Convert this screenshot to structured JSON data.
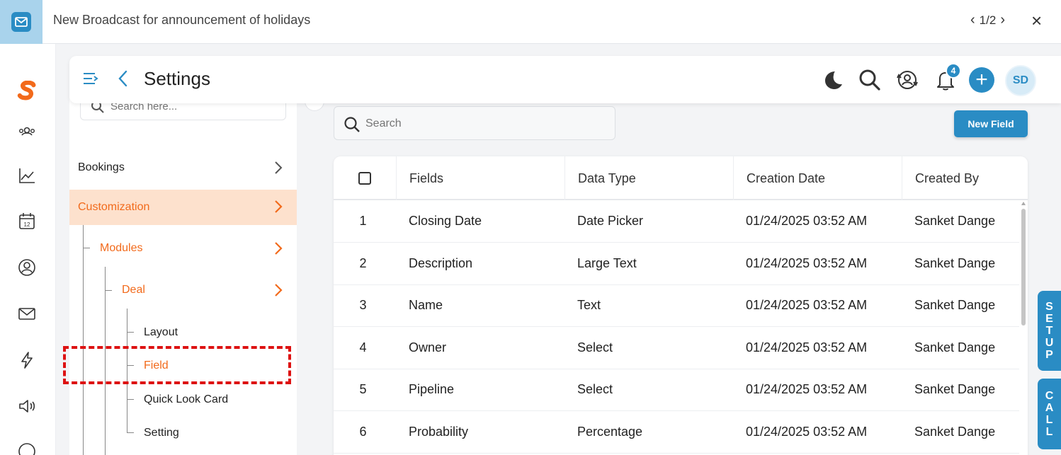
{
  "banner": {
    "text": "New Broadcast for announcement of holidays",
    "pager": "1/2",
    "close_glyph": "×",
    "icon": "mail-icon"
  },
  "rail": {
    "items": [
      "logo-icon",
      "contacts-icon",
      "analytics-icon",
      "calendar-icon",
      "user-icon",
      "mail-icon",
      "bolt-icon",
      "speaker-icon",
      "currency-icon"
    ],
    "calendar_day": "12"
  },
  "header": {
    "title": "Settings",
    "notification_count": "4",
    "plus_glyph": "+",
    "avatar_initials": "SD"
  },
  "side_panel": {
    "search_placeholder": "Search here...",
    "items": {
      "bookings": "Bookings",
      "customization": "Customization",
      "modules": "Modules",
      "deal": "Deal",
      "layout": "Layout",
      "field": "Field",
      "quick_look_card": "Quick Look Card",
      "setting": "Setting"
    }
  },
  "main": {
    "search_placeholder": "Search",
    "new_field_label": "New Field",
    "table": {
      "headers": [
        "Fields",
        "Data Type",
        "Creation Date",
        "Created By"
      ],
      "rows": [
        {
          "num": "1",
          "field": "Closing Date",
          "type": "Date Picker",
          "date": "01/24/2025 03:52 AM",
          "by": "Sanket Dange"
        },
        {
          "num": "2",
          "field": "Description",
          "type": "Large Text",
          "date": "01/24/2025 03:52 AM",
          "by": "Sanket Dange"
        },
        {
          "num": "3",
          "field": "Name",
          "type": "Text",
          "date": "01/24/2025 03:52 AM",
          "by": "Sanket Dange"
        },
        {
          "num": "4",
          "field": "Owner",
          "type": "Select",
          "date": "01/24/2025 03:52 AM",
          "by": "Sanket Dange"
        },
        {
          "num": "5",
          "field": "Pipeline",
          "type": "Select",
          "date": "01/24/2025 03:52 AM",
          "by": "Sanket Dange"
        },
        {
          "num": "6",
          "field": "Probability",
          "type": "Percentage",
          "date": "01/24/2025 03:52 AM",
          "by": "Sanket Dange"
        }
      ]
    }
  },
  "side_tabs": {
    "setup": [
      "S",
      "E",
      "T",
      "U",
      "P"
    ],
    "call": [
      "C",
      "A",
      "L",
      "L"
    ]
  },
  "colors": {
    "accent": "#2a8cc4",
    "orange": "#f26a1b",
    "selected_row_bg": "#fde1cd",
    "highlight_dash": "#dd1111"
  }
}
